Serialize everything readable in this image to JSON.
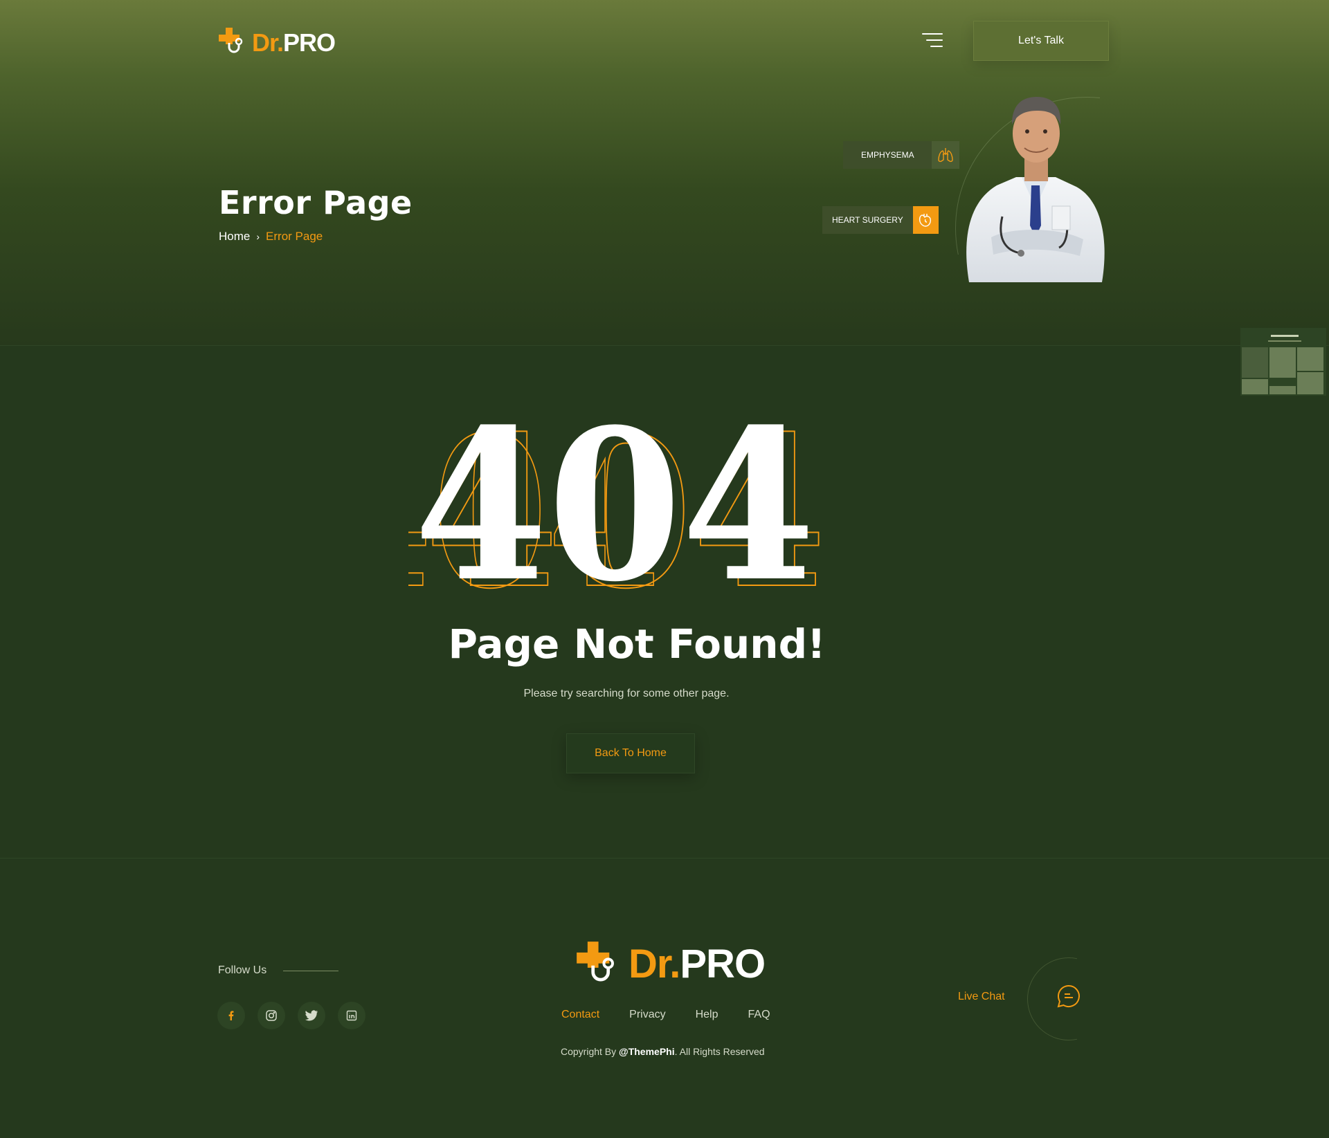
{
  "colors": {
    "accent": "#f39a12",
    "bg": "#25391d",
    "hero_top": "#6a7a3b"
  },
  "header": {
    "logo_dr": "Dr.",
    "logo_pro": "PRO",
    "cta_label": "Let's Talk",
    "menu_icon": "hamburger-icon"
  },
  "hero": {
    "title": "Error Page",
    "breadcrumb": {
      "home": "Home",
      "separator": "›",
      "current": "Error Page"
    },
    "tags": [
      {
        "label": "EMPHYSEMA",
        "icon": "lungs-icon"
      },
      {
        "label": "HEART SURGERY",
        "icon": "heart-icon"
      }
    ]
  },
  "main": {
    "code": "404",
    "title": "Page Not Found!",
    "subtitle": "Please try searching for some other page.",
    "button": "Back To Home"
  },
  "footer": {
    "follow_label": "Follow Us",
    "socials": [
      "facebook-icon",
      "instagram-icon",
      "twitter-icon",
      "linkedin-icon"
    ],
    "logo_dr": "Dr.",
    "logo_pro": "PRO",
    "links": [
      "Contact",
      "Privacy",
      "Help",
      "FAQ"
    ],
    "copyright_prefix": "Copyright By ",
    "copyright_brand": "@ThemePhi",
    "copyright_suffix": ". All Rights Reserved",
    "live_chat": "Live Chat"
  }
}
